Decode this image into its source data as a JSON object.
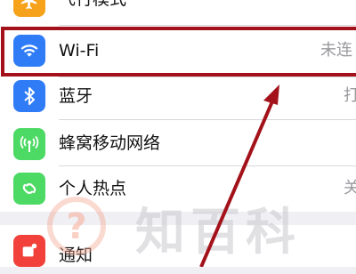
{
  "settings": {
    "rows": [
      {
        "label": "飞行模式",
        "value": "",
        "icon": "airplane-icon",
        "color": "#f7a21b"
      },
      {
        "label": "Wi-Fi",
        "value": "未连",
        "icon": "wifi-icon",
        "color": "#2f7cf6"
      },
      {
        "label": "蓝牙",
        "value": "打",
        "icon": "bluetooth-icon",
        "color": "#2f7cf6"
      },
      {
        "label": "蜂窝移动网络",
        "value": "",
        "icon": "antenna-icon",
        "color": "#4cd964"
      },
      {
        "label": "个人热点",
        "value": "关",
        "icon": "hotspot-icon",
        "color": "#4cd964"
      },
      {
        "label": "通知",
        "value": "",
        "icon": "notifications-icon",
        "color": "#f2413b"
      }
    ]
  },
  "highlight": {
    "color": "#a3121a",
    "target": "Wi-Fi"
  },
  "watermark": {
    "text": "知百科"
  }
}
